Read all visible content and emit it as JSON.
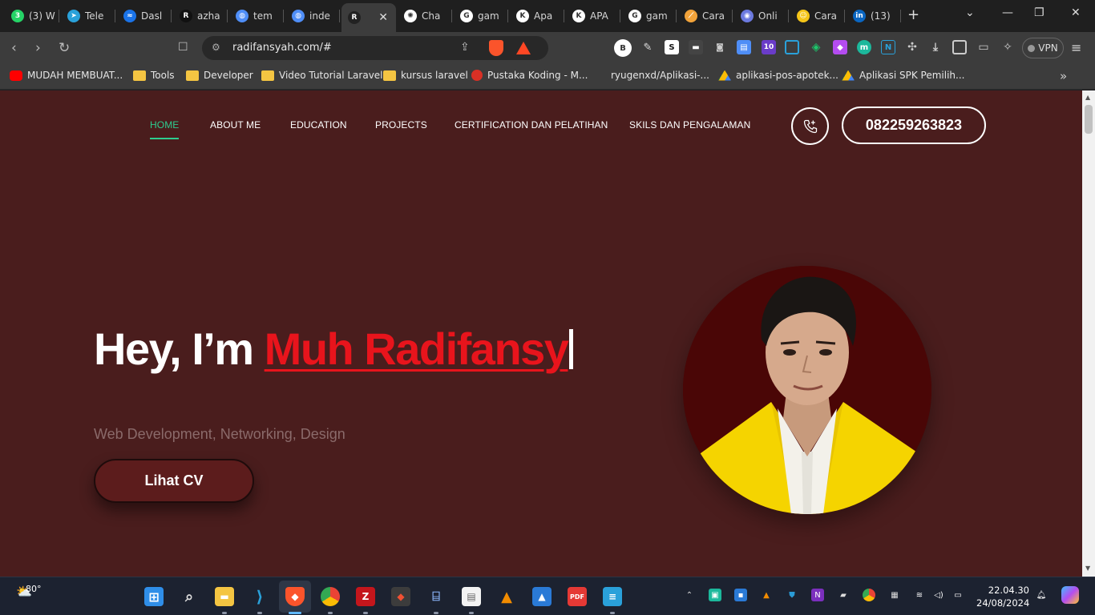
{
  "browser": {
    "tabs": [
      {
        "label": "(3) W",
        "icon": "whatsapp-icon",
        "color": "#25d366",
        "glyph": "3"
      },
      {
        "label": "Tele",
        "icon": "telegram-icon",
        "color": "#2aa1da",
        "glyph": "➤"
      },
      {
        "label": "Dasl",
        "icon": "dashboard-icon",
        "color": "#1a73e8",
        "glyph": "≈"
      },
      {
        "label": "azha",
        "icon": "github-like-icon",
        "color": "#111111",
        "glyph": "R"
      },
      {
        "label": "tem",
        "icon": "doc-icon",
        "color": "#4f8ef7",
        "glyph": "◍"
      },
      {
        "label": "inde",
        "icon": "doc-icon",
        "color": "#4f8ef7",
        "glyph": "◍"
      },
      {
        "label": "",
        "icon": "site-icon",
        "color": "#222222",
        "glyph": "R"
      },
      {
        "label": "Cha",
        "icon": "chatgpt-icon",
        "color": "#ffffff",
        "glyph": "✺"
      },
      {
        "label": "gam",
        "icon": "google-icon",
        "color": "#ffffff",
        "glyph": "G"
      },
      {
        "label": "Apa",
        "icon": "kompas-icon",
        "color": "#ffffff",
        "glyph": "K"
      },
      {
        "label": "APA",
        "icon": "kompas-icon",
        "color": "#ffffff",
        "glyph": "K"
      },
      {
        "label": "gam",
        "icon": "google-icon",
        "color": "#ffffff",
        "glyph": "G"
      },
      {
        "label": "Cara",
        "icon": "link-icon",
        "color": "#f2a33a",
        "glyph": "⟋"
      },
      {
        "label": "Onli",
        "icon": "online-icon",
        "color": "#6c7ae0",
        "glyph": "◉"
      },
      {
        "label": "Cara",
        "icon": "emoji-icon",
        "color": "#f5c518",
        "glyph": "☺"
      },
      {
        "label": "(13)",
        "icon": "linkedin-icon",
        "color": "#0a66c2",
        "glyph": "in"
      }
    ],
    "url": "radifansyah.com/#",
    "vpn_label": "VPN",
    "extension_badge": "10",
    "profile_letter": "B",
    "bookmarks": [
      {
        "label": "MUDAH MEMBUAT...",
        "type": "youtube"
      },
      {
        "label": "Tools",
        "type": "folder"
      },
      {
        "label": "Developer",
        "type": "folder"
      },
      {
        "label": "Video Tutorial Laravel",
        "type": "folder"
      },
      {
        "label": "kursus laravel",
        "type": "folder"
      },
      {
        "label": "Pustaka Koding - M...",
        "type": "site"
      },
      {
        "label": "ryugenxd/Aplikasi-...",
        "type": "github"
      },
      {
        "label": "aplikasi-pos-apotek...",
        "type": "drive"
      },
      {
        "label": "Aplikasi SPK Pemilih...",
        "type": "drive"
      }
    ]
  },
  "site": {
    "nav": [
      "HOME",
      "ABOUT ME",
      "EDUCATION",
      "PROJECTS",
      "CERTIFICATION DAN PELATIHAN",
      "SKILS DAN PENGALAMAN"
    ],
    "phone": "082259263823",
    "hero_prefix": "Hey, I’m ",
    "hero_name": "Muh Radifansy",
    "subtitle": "Web Development, Networking, Design",
    "cta": "Lihat CV",
    "colors": {
      "background": "#4a1d1d",
      "accent": "#e8141c",
      "active_nav": "#2ecc8f"
    }
  },
  "taskbar": {
    "temperature": "80°",
    "time": "22.04.30",
    "date": "24/08/2024"
  }
}
